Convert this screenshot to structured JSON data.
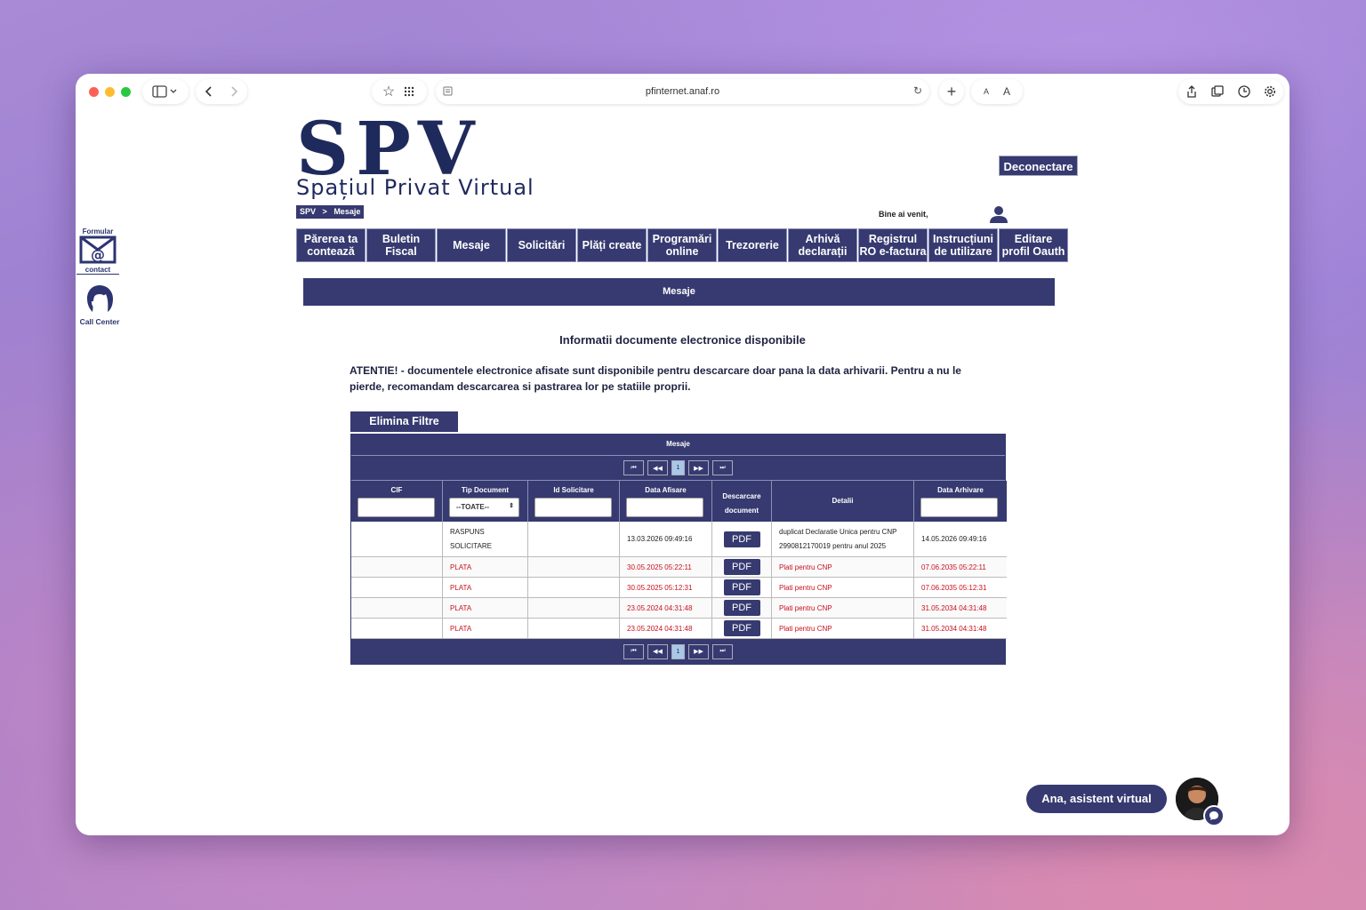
{
  "browser": {
    "url": "pfinternet.anaf.ro"
  },
  "logo": {
    "title": "SPV",
    "subtitle": "Spațiul Privat Virtual"
  },
  "breadcrumb": {
    "root": "SPV",
    "sep": ">",
    "current": "Mesaje"
  },
  "header": {
    "logout": "Deconectare",
    "welcome": "Bine ai venit,"
  },
  "nav": [
    "Părerea ta contează",
    "Buletin Fiscal",
    "Mesaje",
    "Solicitări",
    "Plăți create",
    "Programări online",
    "Trezorerie",
    "Arhivă declarații",
    "Registrul RO e-factura",
    "Instrucțiuni de utilizare",
    "Editare profil Oauth"
  ],
  "side": {
    "form_top": "Formular",
    "form_bottom": "contact",
    "callcenter": "Call Center"
  },
  "band_title": "Mesaje",
  "section_title": "Informatii documente electronice disponibile",
  "warning": "ATENTIE! - documentele electronice afisate sunt disponibile pentru descarcare doar pana la data arhivarii. Pentru a nu le pierde, recomandam descarcarea si pastrarea lor pe statiile proprii.",
  "filter_button": "Elimina Filtre",
  "table": {
    "caption": "Mesaje",
    "pager": {
      "first": "⏮",
      "prev": "◀◀",
      "page": "1",
      "next": "▶▶",
      "last": "⏭"
    },
    "columns": [
      "CIF",
      "Tip Document",
      "Id Solicitare",
      "Data Afisare",
      "Descarcare document",
      "Detalii",
      "Data Arhivare"
    ],
    "select_value": "--TOATE--",
    "pdf_label": "PDF",
    "rows": [
      {
        "cif": "",
        "tip": "RASPUNS SOLICITARE",
        "id": "",
        "afisare": "13.03.2026 09:49:16",
        "detalii": "duplicat Declaratie Unica pentru CNP 2990812170019 pentru anul 2025",
        "arhivare": "14.05.2026 09:49:16"
      },
      {
        "cif": "",
        "tip": "PLATA",
        "id": "",
        "afisare": "30.05.2025 05:22:11",
        "detalii": "Plati pentru CNP",
        "arhivare": "07.06.2035 05:22:11"
      },
      {
        "cif": "",
        "tip": "PLATA",
        "id": "",
        "afisare": "30.05.2025 05:12:31",
        "detalii": "Plati pentru CNP",
        "arhivare": "07.06.2035 05:12:31"
      },
      {
        "cif": "",
        "tip": "PLATA",
        "id": "",
        "afisare": "23.05.2024 04:31:48",
        "detalii": "Plati pentru CNP",
        "arhivare": "31.05.2034 04:31:48"
      },
      {
        "cif": "",
        "tip": "PLATA",
        "id": "",
        "afisare": "23.05.2024 04:31:48",
        "detalii": "Plati pentru CNP",
        "arhivare": "31.05.2034 04:31:48"
      }
    ]
  },
  "assistant": {
    "label": "Ana, asistent virtual"
  },
  "colors": {
    "navy": "#363a70",
    "red": "#c8101d"
  }
}
